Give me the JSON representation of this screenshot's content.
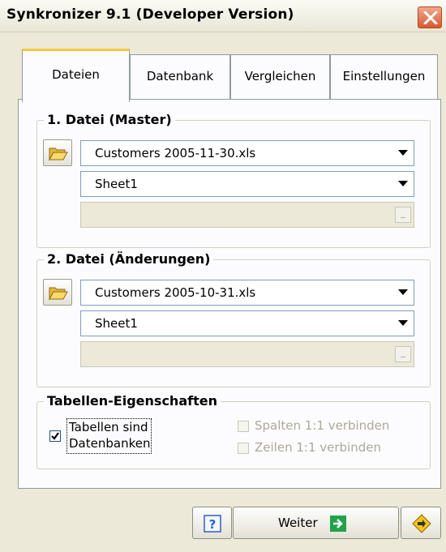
{
  "window": {
    "title": "Synkronizer 9.1 (Developer Version)"
  },
  "tabs": [
    {
      "label": "Dateien",
      "active": true
    },
    {
      "label": "Datenbank",
      "active": false
    },
    {
      "label": "Vergleichen",
      "active": false
    },
    {
      "label": "Einstellungen",
      "active": false
    }
  ],
  "master": {
    "group_title": "1. Datei (Master)",
    "file_value": "Customers 2005-11-30.xls",
    "sheet_value": "Sheet1",
    "path_value": ""
  },
  "changes": {
    "group_title": "2. Datei (Änderungen)",
    "file_value": "Customers 2005-10-31.xls",
    "sheet_value": "Sheet1",
    "path_value": ""
  },
  "table_props": {
    "group_title": "Tabellen-Eigenschaften",
    "tables_are_db_line1": "Tabellen sind",
    "tables_are_db_line2": "Datenbanken",
    "tables_are_db_checked": true,
    "columns_1to1": "Spalten 1:1 verbinden",
    "rows_1to1": "Zeilen 1:1 verbinden"
  },
  "buttons": {
    "weiter": "Weiter"
  },
  "icons": {
    "close": "close-icon",
    "folder": "open-folder-icon",
    "help": "help-icon",
    "next": "arrow-right-icon",
    "diamond": "arrow-diamond-icon"
  },
  "colors": {
    "window_bg": "#ece9d8",
    "close_red": "#d9572f",
    "tab_highlight": "#ffc83c",
    "next_green": "#22a24a",
    "help_blue": "#2f5fc4"
  }
}
